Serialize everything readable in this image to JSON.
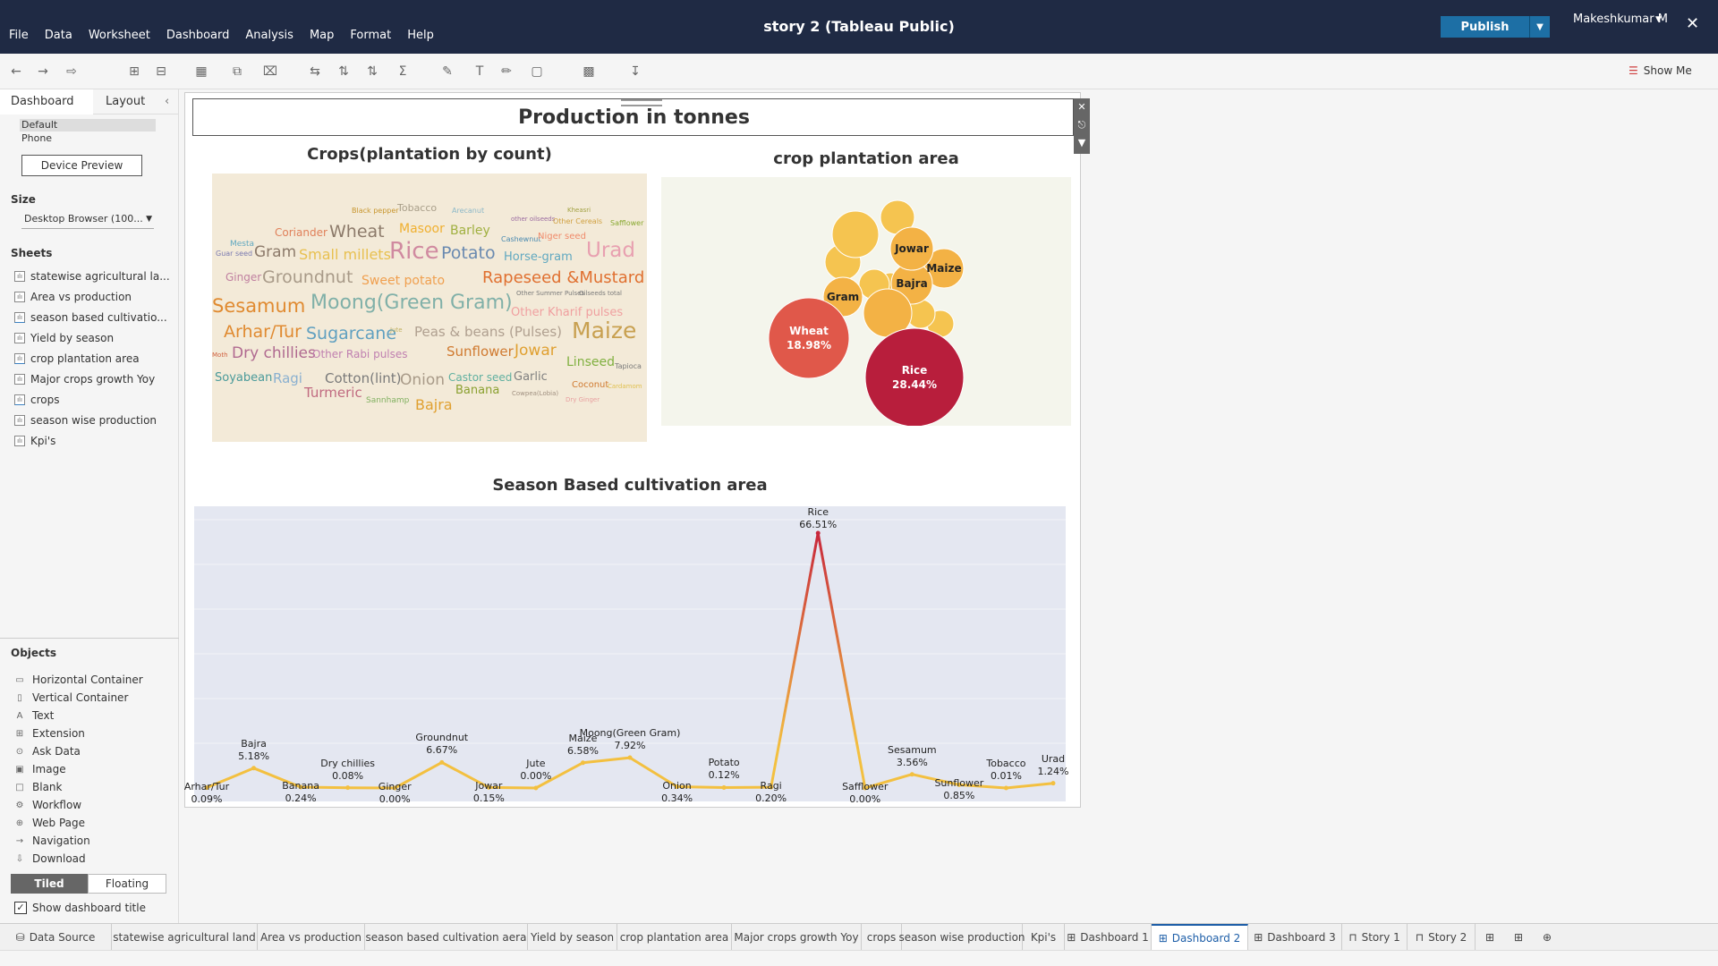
{
  "app": {
    "title": "story 2 (Tableau Public)",
    "menu": [
      "File",
      "Data",
      "Worksheet",
      "Dashboard",
      "Analysis",
      "Map",
      "Format",
      "Help"
    ],
    "publish_label": "Publish",
    "user_name": "Makeshkumar M",
    "show_me_label": "Show Me"
  },
  "left_panel": {
    "tab_dashboard": "Dashboard",
    "tab_layout": "Layout",
    "devices": [
      "Default",
      "Phone"
    ],
    "device_preview_label": "Device Preview",
    "size_heading": "Size",
    "size_value": "Desktop Browser (100...",
    "sheets_heading": "Sheets",
    "sheets": [
      "statewise agricultural la...",
      "Area vs production",
      "season based cultivatio...",
      "Yield by season",
      "crop plantation area",
      "Major crops growth Yoy",
      "crops",
      "season wise production",
      "Kpi's"
    ],
    "objects_heading": "Objects",
    "objects": [
      "Horizontal Container",
      "Vertical Container",
      "Text",
      "Extension",
      "Ask Data",
      "Image",
      "Blank",
      "Workflow",
      "Web Page",
      "Navigation",
      "Download"
    ],
    "tiled_label": "Tiled",
    "floating_label": "Floating",
    "show_title_label": "Show dashboard title"
  },
  "dashboard": {
    "title": "Production in tonnes",
    "wordcloud_title": "Crops(plantation by count)",
    "bubble_title": "crop plantation area",
    "line_title": "Season Based cultivation area"
  },
  "wordcloud": [
    {
      "text": "Black pepper",
      "c": "#c8962e",
      "s": 8
    },
    {
      "text": "Tobacco",
      "c": "#a99f8a",
      "s": 11
    },
    {
      "text": "Arecanut",
      "c": "#8cb8c8",
      "s": 8
    },
    {
      "text": "Kheasri",
      "c": "#a0a040",
      "s": 7
    },
    {
      "text": "other oilseeds",
      "c": "#9a6aa0",
      "s": 7
    },
    {
      "text": "Other Cereals",
      "c": "#d0a040",
      "s": 8
    },
    {
      "text": "Safflower",
      "c": "#88a830",
      "s": 8
    },
    {
      "text": "Coriander",
      "c": "#e0805a",
      "s": 12
    },
    {
      "text": "Wheat",
      "c": "#8c7a6a",
      "s": 19
    },
    {
      "text": "Masoor",
      "c": "#f0b030",
      "s": 14
    },
    {
      "text": "Barley",
      "c": "#a0b040",
      "s": 14
    },
    {
      "text": "Cashewnut",
      "c": "#4a8ab0",
      "s": 8
    },
    {
      "text": "Niger seed",
      "c": "#f08a6a",
      "s": 10
    },
    {
      "text": "Mesta",
      "c": "#60a8c0",
      "s": 9
    },
    {
      "text": "Guar seed",
      "c": "#7a7ab0",
      "s": 8
    },
    {
      "text": "Gram",
      "c": "#8c7a6a",
      "s": 17
    },
    {
      "text": "Small millets",
      "c": "#e8c050",
      "s": 16
    },
    {
      "text": "Rice",
      "c": "#d08aa0",
      "s": 26
    },
    {
      "text": "Potato",
      "c": "#6a8ab0",
      "s": 19
    },
    {
      "text": "Horse-gram",
      "c": "#60a8c0",
      "s": 13
    },
    {
      "text": "Urad",
      "c": "#e8a0b0",
      "s": 23
    },
    {
      "text": "Ginger",
      "c": "#c080a0",
      "s": 12
    },
    {
      "text": "Groundnut",
      "c": "#a89a88",
      "s": 19
    },
    {
      "text": "Sweet potato",
      "c": "#f0a050",
      "s": 14
    },
    {
      "text": "Rapeseed &Mustard",
      "c": "#e07030",
      "s": 18
    },
    {
      "text": "Sesamum",
      "c": "#e08a30",
      "s": 21
    },
    {
      "text": "Moong(Green Gram)",
      "c": "#80b0a8",
      "s": 22
    },
    {
      "text": "Other Summer Pulses",
      "c": "#7a7a7a",
      "s": 7
    },
    {
      "text": "Oilseeds total",
      "c": "#7a7a7a",
      "s": 7
    },
    {
      "text": "Other Kharif pulses",
      "c": "#f0a0a0",
      "s": 13
    },
    {
      "text": "Arhar/Tur",
      "c": "#e08a30",
      "s": 19
    },
    {
      "text": "Sugarcane",
      "c": "#60a0c0",
      "s": 19
    },
    {
      "text": "Jute",
      "c": "#c0b060",
      "s": 7
    },
    {
      "text": "Peas & beans (Pulses)",
      "c": "#b0a090",
      "s": 15
    },
    {
      "text": "Maize",
      "c": "#c8a050",
      "s": 25
    },
    {
      "text": "Moth",
      "c": "#d06040",
      "s": 7
    },
    {
      "text": "Dry chillies",
      "c": "#b06a90",
      "s": 17
    },
    {
      "text": "Other Rabi pulses",
      "c": "#c080b0",
      "s": 12
    },
    {
      "text": "Sunflower",
      "c": "#d07a30",
      "s": 15
    },
    {
      "text": "Jowar",
      "c": "#e0a030",
      "s": 17
    },
    {
      "text": "Linseed",
      "c": "#80b040",
      "s": 14
    },
    {
      "text": "Tapioca",
      "c": "#7a7a7a",
      "s": 8
    },
    {
      "text": "Soyabean",
      "c": "#4a9a9a",
      "s": 13
    },
    {
      "text": "Ragi",
      "c": "#8ab0d0",
      "s": 15
    },
    {
      "text": "Cotton(lint)",
      "c": "#7a7a7a",
      "s": 15
    },
    {
      "text": "Onion",
      "c": "#a89a88",
      "s": 17
    },
    {
      "text": "Castor seed",
      "c": "#60b0a0",
      "s": 12
    },
    {
      "text": "Garlic",
      "c": "#808080",
      "s": 13
    },
    {
      "text": "Coconut",
      "c": "#d07a30",
      "s": 10
    },
    {
      "text": "Cardamom",
      "c": "#e0c050",
      "s": 7
    },
    {
      "text": "Turmeric",
      "c": "#c06a80",
      "s": 15
    },
    {
      "text": "Sannhamp",
      "c": "#80b060",
      "s": 9
    },
    {
      "text": "Bajra",
      "c": "#e0a030",
      "s": 16
    },
    {
      "text": "Banana",
      "c": "#8aa030",
      "s": 13
    },
    {
      "text": "Cowpea(Lobia)",
      "c": "#a09080",
      "s": 7
    },
    {
      "text": "Dry Ginger",
      "c": "#e8a0a0",
      "s": 7
    }
  ],
  "bubbles": [
    {
      "label": "Rice",
      "pct": "28.44%",
      "c": "#b81e3c",
      "r": 55
    },
    {
      "label": "Wheat",
      "pct": "18.98%",
      "c": "#e0584a",
      "r": 45
    },
    {
      "label": "Jowar",
      "pct": "",
      "c": "#f3b245",
      "r": 24
    },
    {
      "label": "Maize",
      "pct": "",
      "c": "#f3b245",
      "r": 22
    },
    {
      "label": "Bajra",
      "pct": "",
      "c": "#f3b245",
      "r": 23
    },
    {
      "label": "Gram",
      "pct": "",
      "c": "#f3b245",
      "r": 22
    },
    {
      "label": "",
      "pct": "",
      "c": "#f5c450",
      "r": 26
    },
    {
      "label": "",
      "pct": "",
      "c": "#f3b245",
      "r": 27
    },
    {
      "label": "",
      "pct": "",
      "c": "#f5c450",
      "r": 19
    },
    {
      "label": "",
      "pct": "",
      "c": "#f5c450",
      "r": 20
    },
    {
      "label": "",
      "pct": "",
      "c": "#f5c450",
      "r": 17
    },
    {
      "label": "",
      "pct": "",
      "c": "#f5c450",
      "r": 16
    },
    {
      "label": "",
      "pct": "",
      "c": "#f5c450",
      "r": 15
    },
    {
      "label": "",
      "pct": "",
      "c": "#f5c450",
      "r": 14
    }
  ],
  "chart_data": {
    "type": "line",
    "title": "Season Based cultivation area",
    "series": [
      {
        "values": [
          {
            "x": "Arhar/Tur",
            "y": 0.09
          },
          {
            "x": "Bajra",
            "y": 5.18
          },
          {
            "x": "Banana",
            "y": 0.24
          },
          {
            "x": "Dry chillies",
            "y": 0.08
          },
          {
            "x": "Ginger",
            "y": 0.0
          },
          {
            "x": "Groundnut",
            "y": 6.67
          },
          {
            "x": "Jowar",
            "y": 0.15
          },
          {
            "x": "Jute",
            "y": 0.0
          },
          {
            "x": "Maize",
            "y": 6.58
          },
          {
            "x": "Moong(Green Gram)",
            "y": 7.92
          },
          {
            "x": "Onion",
            "y": 0.34
          },
          {
            "x": "Potato",
            "y": 0.12
          },
          {
            "x": "Ragi",
            "y": 0.2
          },
          {
            "x": "Rice",
            "y": 66.51
          },
          {
            "x": "Safflower",
            "y": 0.0
          },
          {
            "x": "Sesamum",
            "y": 3.56
          },
          {
            "x": "Sunflower",
            "y": 0.85
          },
          {
            "x": "Tobacco",
            "y": 0.01
          },
          {
            "x": "Urad",
            "y": 1.24
          }
        ]
      }
    ],
    "labels": [
      {
        "name": "Arhar/Tur",
        "pct": "0.09%"
      },
      {
        "name": "Bajra",
        "pct": "5.18%"
      },
      {
        "name": "Banana",
        "pct": "0.24%"
      },
      {
        "name": "Dry chillies",
        "pct": "0.08%"
      },
      {
        "name": "Ginger",
        "pct": "0.00%"
      },
      {
        "name": "Groundnut",
        "pct": "6.67%"
      },
      {
        "name": "Jowar",
        "pct": "0.15%"
      },
      {
        "name": "Jute",
        "pct": "0.00%"
      },
      {
        "name": "Maize",
        "pct": "6.58%"
      },
      {
        "name": "Moong(Green Gram)",
        "pct": "7.92%"
      },
      {
        "name": "Onion",
        "pct": "0.34%"
      },
      {
        "name": "Potato",
        "pct": "0.12%"
      },
      {
        "name": "Ragi",
        "pct": "0.20%"
      },
      {
        "name": "Rice",
        "pct": "66.51%"
      },
      {
        "name": "Safflower",
        "pct": "0.00%"
      },
      {
        "name": "Sesamum",
        "pct": "3.56%"
      },
      {
        "name": "Sunflower",
        "pct": "0.85%"
      },
      {
        "name": "Tobacco",
        "pct": "0.01%"
      },
      {
        "name": "Urad",
        "pct": "1.24%"
      }
    ],
    "ylim": [
      0,
      70
    ],
    "grid": true,
    "line_color_low": "#f3c040",
    "line_color_high": "#c8283c"
  },
  "bottom_tabs": [
    "Data Source",
    "statewise agricultural land",
    "Area vs production",
    "season based cultivation aera",
    "Yield by season",
    "crop plantation area",
    "Major crops growth Yoy",
    "crops",
    "season wise production",
    "Kpi's",
    "Dashboard 1",
    "Dashboard 2",
    "Dashboard 3",
    "Story 1",
    "Story 2"
  ],
  "active_tab": "Dashboard 2",
  "colors": {
    "topbar": "#1f2a44",
    "publish": "#1d6fa5",
    "active_tab": "#1d5ea8"
  }
}
